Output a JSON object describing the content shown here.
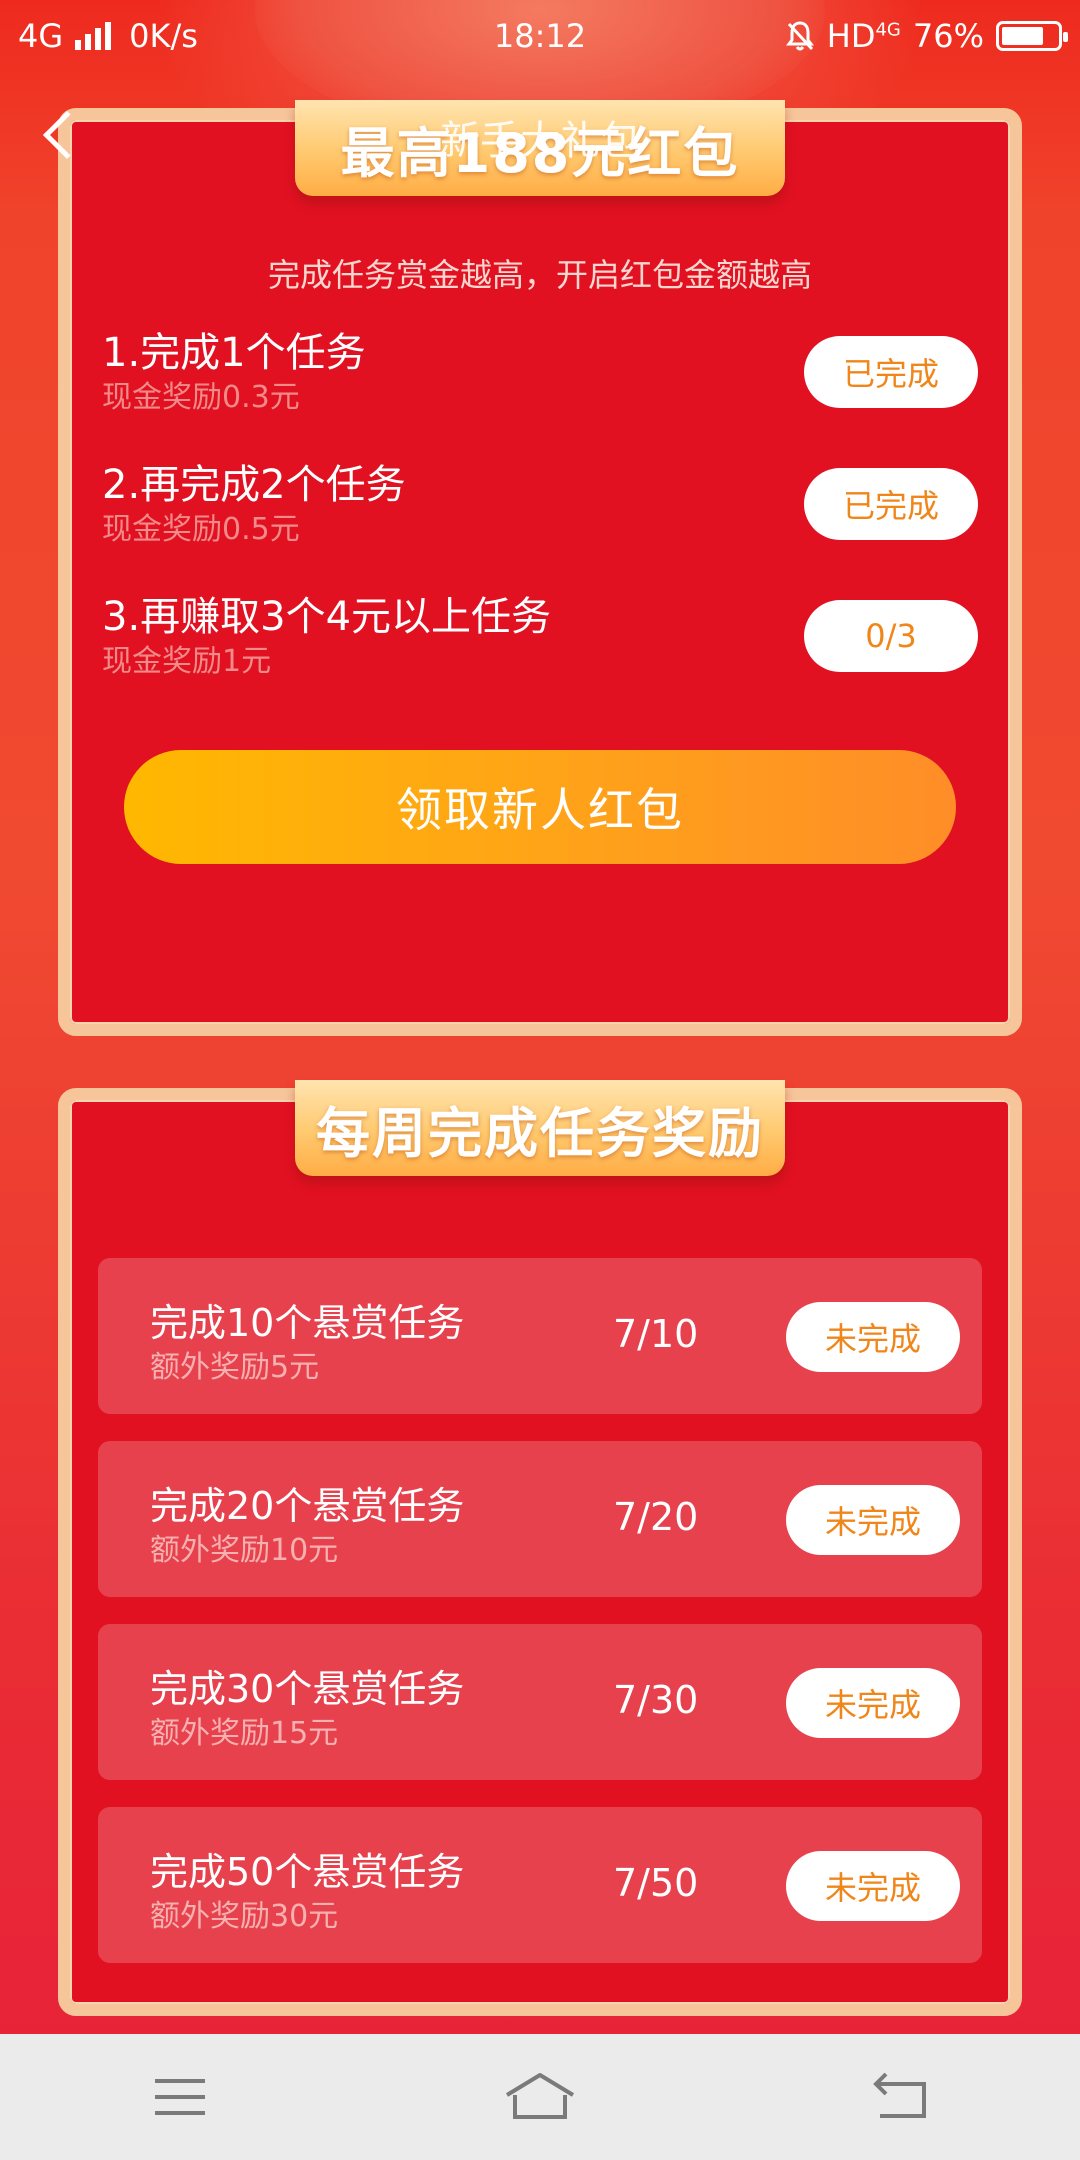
{
  "status_bar": {
    "network": "4G",
    "speed": "0K/s",
    "time": "18:12",
    "hd": "HD",
    "hd_network": "4G",
    "battery": "76%"
  },
  "header": {
    "title": "新手大礼包"
  },
  "newbie_card": {
    "ribbon": "最高188元红包",
    "subtitle": "完成任务赏金越高，开启红包金额越高",
    "tasks": [
      {
        "title": "1.完成1个任务",
        "reward": "现金奖励0.3元",
        "status": "已完成"
      },
      {
        "title": "2.再完成2个任务",
        "reward": "现金奖励0.5元",
        "status": "已完成"
      },
      {
        "title": "3.再赚取3个4元以上任务",
        "reward": "现金奖励1元",
        "status": "0/3"
      }
    ],
    "claim_button": "领取新人红包"
  },
  "weekly_card": {
    "ribbon": "每周完成任务奖励",
    "rows": [
      {
        "title": "完成10个悬赏任务",
        "reward": "额外奖励5元",
        "progress": "7/10",
        "status": "未完成"
      },
      {
        "title": "完成20个悬赏任务",
        "reward": "额外奖励10元",
        "progress": "7/20",
        "status": "未完成"
      },
      {
        "title": "完成30个悬赏任务",
        "reward": "额外奖励15元",
        "progress": "7/30",
        "status": "未完成"
      },
      {
        "title": "完成50个悬赏任务",
        "reward": "额外奖励30元",
        "progress": "7/50",
        "status": "未完成"
      }
    ]
  },
  "colors": {
    "card_bg": "#e11122",
    "card_border": "#f7c59a",
    "pill_text": "#f0861a",
    "button_gradient_start": "#ffb800",
    "button_gradient_end": "#ff8d28"
  }
}
